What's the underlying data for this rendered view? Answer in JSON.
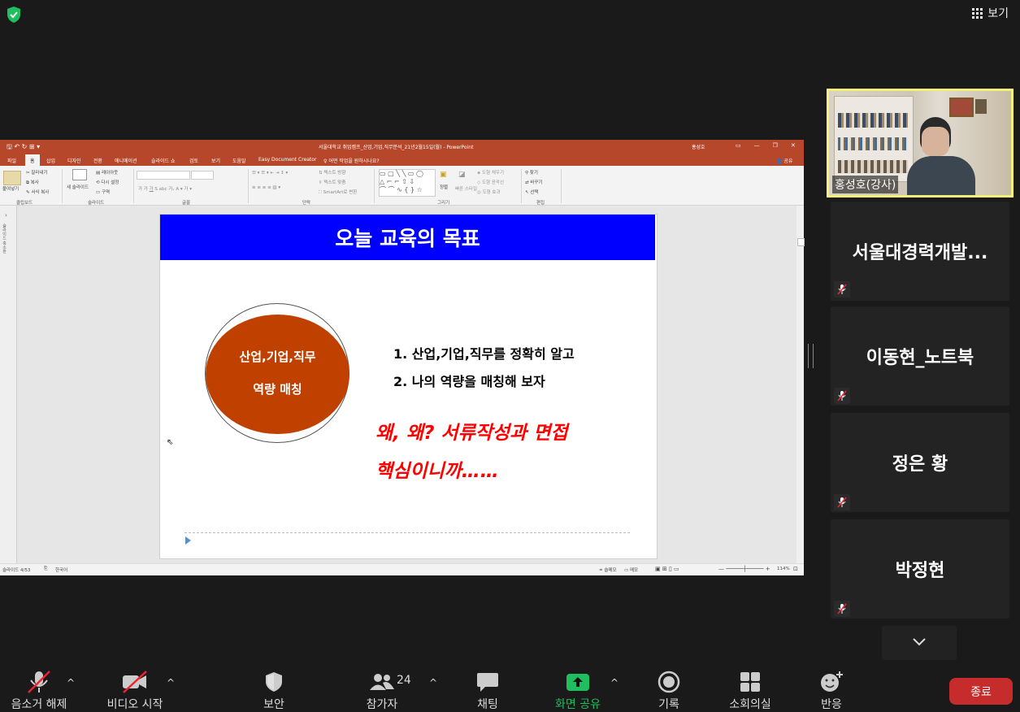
{
  "topbar": {
    "view_label": "보기"
  },
  "ppt": {
    "title": "서울대학교 취업캠프_산업,기업,직무분석_21년2월15일(월)  -  PowerPoint",
    "user": "홍성호",
    "tabs": [
      "파일",
      "홈",
      "삽입",
      "디자인",
      "전환",
      "애니메이션",
      "슬라이드 쇼",
      "검토",
      "보기",
      "도움말",
      "Easy Document Creator"
    ],
    "tell_me": "어떤 작업을 원하시나요?",
    "share": "공유",
    "ribbon_groups": [
      "클립보드",
      "슬라이드",
      "글꼴",
      "단락",
      "그리기",
      "편집"
    ],
    "ribbon_items": {
      "paste": "붙여넣기",
      "cut": "잘라내기",
      "copy": "복사",
      "format_painter": "서식 복사",
      "new_slide": "새 슬라이드",
      "layout": "레이아웃",
      "reset": "다시 설정",
      "section": "구역",
      "text_direction": "텍스트 방향",
      "align_text": "텍스트 맞춤",
      "smartart": "SmartArt로 변환",
      "arrange": "정렬",
      "quick_styles": "빠른 스타일",
      "shape_fill": "도형 채우기",
      "shape_outline": "도형 윤곽선",
      "shape_effects": "도형 효과",
      "find": "찾기",
      "replace": "바꾸기",
      "select": "선택"
    },
    "left_pane_label": "슬라이드 축소판",
    "status": {
      "slide": "슬라이드 4/53",
      "language": "한국어",
      "notes": "슬메모",
      "comments": "메모",
      "zoom": "114%"
    }
  },
  "slide": {
    "title": "오늘 교육의 목표",
    "circle_line1": "산업,기업,직무",
    "circle_line2": "역량 매칭",
    "point1": "1. 산업,기업,직무를 정확히 알고",
    "point2": "2. 나의 역량을 매칭해 보자",
    "hand1": "왜, 왜? 서류작성과 면접",
    "hand2": "핵심이니까……"
  },
  "participants": {
    "speaker": "홍성호(강사)",
    "others": [
      "서울대경력개발...",
      "이동현_노트북",
      "정은 황",
      "박정현"
    ]
  },
  "toolbar": {
    "unmute": "음소거 해제",
    "start_video": "비디오 시작",
    "security": "보안",
    "participants": "참가자",
    "participants_count": "24",
    "chat": "채팅",
    "share_screen": "화면 공유",
    "record": "기록",
    "breakout": "소회의실",
    "reactions": "반응",
    "end": "종료"
  },
  "colors": {
    "ppt_accent": "#b7472a",
    "slide_title_bg": "#0000ff",
    "circle_fill": "#c04000",
    "handwriting": "#ff0000",
    "speaker_border": "#f5f27a",
    "end_button": "#c72c2c",
    "share_green": "#1fbf5f"
  }
}
